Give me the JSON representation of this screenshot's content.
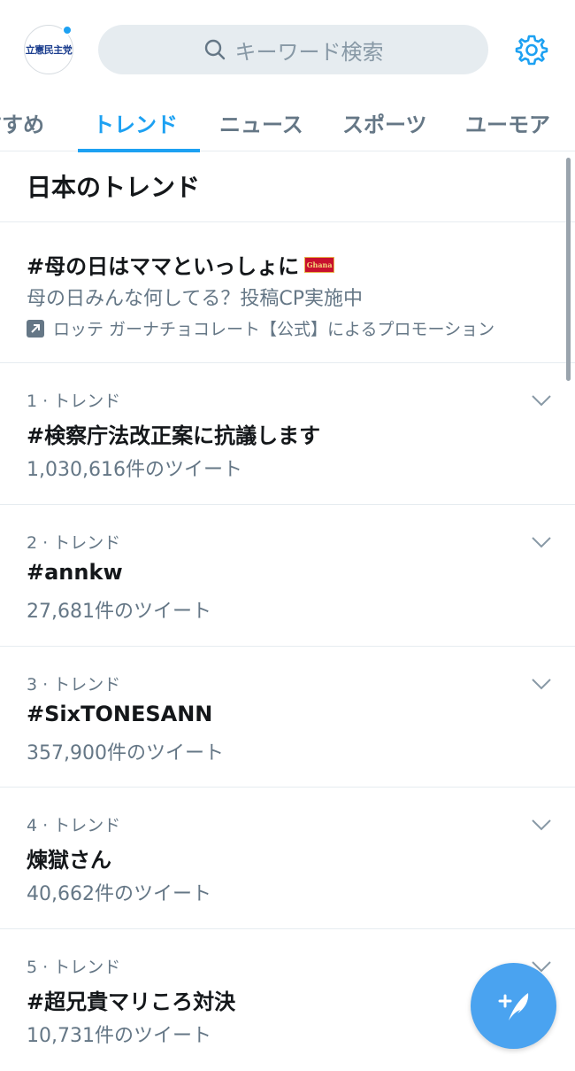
{
  "header": {
    "avatar_text": "立憲民主党",
    "search_placeholder": "キーワード検索",
    "accent_color": "#1da1f2"
  },
  "tabs": [
    {
      "label": "すすめ",
      "active": false
    },
    {
      "label": "トレンド",
      "active": true
    },
    {
      "label": "ニュース",
      "active": false
    },
    {
      "label": "スポーツ",
      "active": false
    },
    {
      "label": "ユーモア",
      "active": false
    }
  ],
  "section_title": "日本のトレンド",
  "promoted": {
    "title": "#母の日はママといっしょに",
    "badge": "Ghana",
    "description": "母の日みんな何してる？投稿CP実施中",
    "promoted_by": "ロッテ ガーナチョコレート【公式】によるプロモーション",
    "icon": "promoted-arrow-icon"
  },
  "trends": [
    {
      "meta": "1 · トレンド",
      "name": "#検察庁法改正案に抗議します",
      "count": "1,030,616件のツイート"
    },
    {
      "meta": "2 · トレンド",
      "name": "#annkw",
      "count": "27,681件のツイート"
    },
    {
      "meta": "3 · トレンド",
      "name": "#SixTONESANN",
      "count": "357,900件のツイート"
    },
    {
      "meta": "4 · トレンド",
      "name": "煉獄さん",
      "count": "40,662件のツイート"
    },
    {
      "meta": "5 · トレンド",
      "name": "#超兄貴マリころ対決",
      "count": "10,731件のツイート"
    }
  ]
}
